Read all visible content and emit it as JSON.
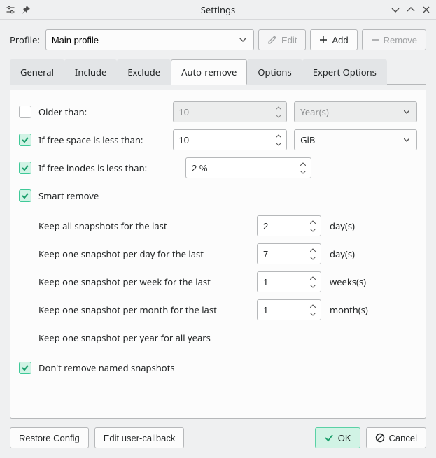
{
  "window": {
    "title": "Settings"
  },
  "profile": {
    "label": "Profile:",
    "selected": "Main profile",
    "edit_label": "Edit",
    "add_label": "Add",
    "remove_label": "Remove"
  },
  "tabs": {
    "general": "General",
    "include": "Include",
    "exclude": "Exclude",
    "auto_remove": "Auto-remove",
    "options": "Options",
    "expert": "Expert Options"
  },
  "auto_remove": {
    "older_than": {
      "label": "Older than:",
      "checked": false,
      "value": "10",
      "unit": "Year(s)"
    },
    "free_space": {
      "label": "If free space is less than:",
      "checked": true,
      "value": "10",
      "unit": "GiB"
    },
    "free_inodes": {
      "label": "If free inodes is less than:",
      "checked": true,
      "value": "2 %"
    },
    "smart": {
      "label": "Smart remove",
      "checked": true,
      "keep_all": {
        "label": "Keep all snapshots for the last",
        "value": "2",
        "unit": "day(s)"
      },
      "per_day": {
        "label": "Keep one snapshot per day for the last",
        "value": "7",
        "unit": "day(s)"
      },
      "per_week": {
        "label": "Keep one snapshot per week for the last",
        "value": "1",
        "unit": "weeks(s)"
      },
      "per_month": {
        "label": "Keep one snapshot per month for the last",
        "value": "1",
        "unit": "month(s)"
      },
      "per_year": {
        "label": "Keep one snapshot per year for all years"
      }
    },
    "dont_remove_named": {
      "label": "Don't remove named snapshots",
      "checked": true
    }
  },
  "footer": {
    "restore": "Restore Config",
    "edit_cb": "Edit user-callback",
    "ok": "OK",
    "cancel": "Cancel"
  }
}
